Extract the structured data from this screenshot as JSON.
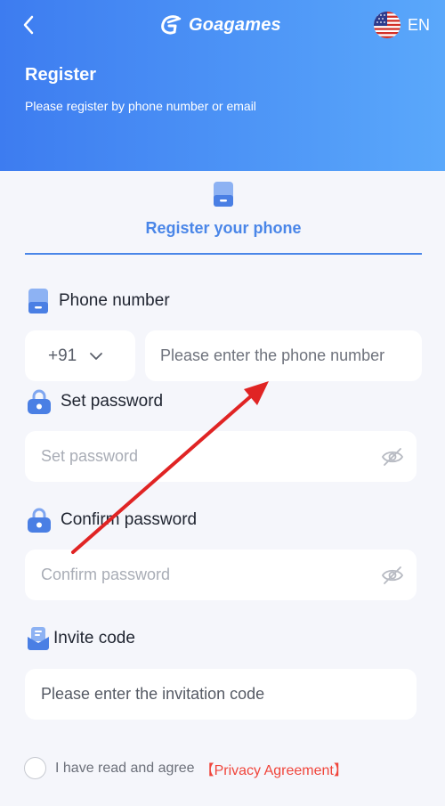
{
  "header": {
    "brand": "Goagames",
    "language": "EN",
    "title": "Register",
    "subtitle": "Please register by phone number or email"
  },
  "tab": {
    "label": "Register your phone"
  },
  "phone": {
    "label": "Phone number",
    "country_code": "+91",
    "placeholder": "Please enter the phone number"
  },
  "password": {
    "label": "Set password",
    "placeholder": "Set password"
  },
  "confirm_password": {
    "label": "Confirm password",
    "placeholder": "Confirm password"
  },
  "invite": {
    "label": "Invite code",
    "placeholder": "Please enter the invitation code"
  },
  "agreement": {
    "text": "I have read and agree",
    "link": "【Privacy Agreement】"
  },
  "icons": {
    "back": "chevron-left-icon",
    "flag": "us-flag-icon",
    "phone": "phone-icon",
    "lock": "lock-icon",
    "eye": "eye-off-icon",
    "invite": "invite-icon"
  },
  "colors": {
    "header_start": "#3d7cf0",
    "header_end": "#5aa8fb",
    "accent": "#4a86e8",
    "link": "#f0463c",
    "annotation_arrow": "#e02424"
  }
}
